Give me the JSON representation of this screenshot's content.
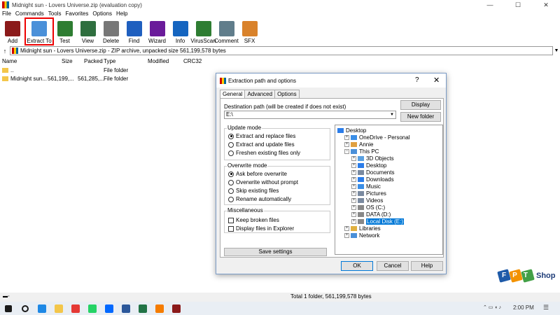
{
  "window": {
    "title": "Midnight sun - Lovers Universe.zip (evaluation copy)",
    "minimize": "—",
    "maximize": "☐",
    "close": "✕"
  },
  "menu": [
    "File",
    "Commands",
    "Tools",
    "Favorites",
    "Options",
    "Help"
  ],
  "toolbar": [
    {
      "label": "Add",
      "icon": "add-archive-icon",
      "color": "#8b1a1a"
    },
    {
      "label": "Extract To",
      "icon": "extract-folder-icon",
      "color": "#4a90d9",
      "selected": true
    },
    {
      "label": "Test",
      "icon": "test-icon",
      "color": "#2e7d32"
    },
    {
      "label": "View",
      "icon": "view-book-icon",
      "color": "#2f6f3f"
    },
    {
      "label": "Delete",
      "icon": "delete-bin-icon",
      "color": "#777777"
    },
    {
      "label": "Find",
      "icon": "find-magnifier-icon",
      "color": "#1f5fbf"
    },
    {
      "label": "Wizard",
      "icon": "wizard-wand-icon",
      "color": "#6a1b9a"
    },
    {
      "label": "Info",
      "icon": "info-icon",
      "color": "#1565c0"
    },
    {
      "label": "VirusScan",
      "icon": "virus-scan-icon",
      "color": "#2e7d32"
    },
    {
      "label": "Comment",
      "icon": "comment-icon",
      "color": "#607d8b"
    },
    {
      "label": "SFX",
      "icon": "sfx-box-icon",
      "color": "#d9822b"
    }
  ],
  "address": {
    "text": "Midnight sun - Lovers Universe.zip - ZIP archive, unpacked size 561,199,578 bytes",
    "up": "↑"
  },
  "columns": [
    "Name",
    "Size",
    "Packed",
    "Type",
    "Modified",
    "CRC32"
  ],
  "files": [
    {
      "name": "..",
      "size": "",
      "packed": "",
      "type": "File folder",
      "modified": "",
      "crc": ""
    },
    {
      "name": "Midnight sun...",
      "size": "561,199,...",
      "packed": "561,285,...",
      "type": "File folder",
      "modified": "",
      "crc": ""
    }
  ],
  "dialog": {
    "title": "Extraction path and options",
    "help": "?",
    "close": "✕",
    "tabs": [
      "General",
      "Advanced",
      "Options"
    ],
    "dest_label": "Destination path (will be created if does not exist)",
    "dest_value": "E:\\",
    "display_btn": "Display",
    "new_folder_btn": "New folder",
    "update_mode": {
      "title": "Update mode",
      "options": [
        "Extract and replace files",
        "Extract and update files",
        "Freshen existing files only"
      ],
      "selected": 0
    },
    "overwrite_mode": {
      "title": "Overwrite mode",
      "options": [
        "Ask before overwrite",
        "Overwrite without prompt",
        "Skip existing files",
        "Rename automatically"
      ],
      "selected": 0
    },
    "misc": {
      "title": "Miscellaneous",
      "options": [
        "Keep broken files",
        "Display files in Explorer"
      ]
    },
    "save_btn": "Save settings",
    "tree": [
      {
        "label": "Desktop",
        "level": 0,
        "exp": "",
        "color": "#2b7de9"
      },
      {
        "label": "OneDrive - Personal",
        "level": 1,
        "exp": "+",
        "color": "#3a8ee6"
      },
      {
        "label": "Annie",
        "level": 1,
        "exp": "+",
        "color": "#e0a040"
      },
      {
        "label": "This PC",
        "level": 1,
        "exp": "−",
        "color": "#4a90d9"
      },
      {
        "label": "3D Objects",
        "level": 2,
        "exp": "+",
        "color": "#5aa0e0"
      },
      {
        "label": "Desktop",
        "level": 2,
        "exp": "+",
        "color": "#2b7de9"
      },
      {
        "label": "Documents",
        "level": 2,
        "exp": "+",
        "color": "#7a8aa0"
      },
      {
        "label": "Downloads",
        "level": 2,
        "exp": "+",
        "color": "#2b7de9"
      },
      {
        "label": "Music",
        "level": 2,
        "exp": "+",
        "color": "#3a8ee6"
      },
      {
        "label": "Pictures",
        "level": 2,
        "exp": "+",
        "color": "#7a8aa0"
      },
      {
        "label": "Videos",
        "level": 2,
        "exp": "+",
        "color": "#7a8aa0"
      },
      {
        "label": "OS (C:)",
        "level": 2,
        "exp": "+",
        "color": "#888888"
      },
      {
        "label": "DATA (D:)",
        "level": 2,
        "exp": "+",
        "color": "#888888"
      },
      {
        "label": "Local Disk (E:)",
        "level": 2,
        "exp": "+",
        "color": "#888888",
        "selected": true
      },
      {
        "label": "Libraries",
        "level": 1,
        "exp": "+",
        "color": "#e0b040"
      },
      {
        "label": "Network",
        "level": 1,
        "exp": "+",
        "color": "#4a90d9"
      }
    ],
    "ok": "OK",
    "cancel": "Cancel",
    "help_btn": "Help"
  },
  "status": {
    "text": "Total 1 folder, 561,199,578 bytes"
  },
  "taskbar": {
    "apps": [
      {
        "icon": "windows-start-icon",
        "color": "#1a1a1a"
      },
      {
        "icon": "search-icon",
        "color": "#1a1a1a"
      },
      {
        "icon": "edge-browser-icon",
        "color": "#1e88e5"
      },
      {
        "icon": "file-explorer-icon",
        "color": "#f3c64a"
      },
      {
        "icon": "chrome-browser-icon",
        "color": "#e53935"
      },
      {
        "icon": "whatsapp-icon",
        "color": "#25d366"
      },
      {
        "icon": "zalo-icon",
        "color": "#0068ff"
      },
      {
        "icon": "word-icon",
        "color": "#2b579a"
      },
      {
        "icon": "excel-icon",
        "color": "#217346"
      },
      {
        "icon": "coccoc-browser-icon",
        "color": "#f57c00"
      },
      {
        "icon": "winrar-taskbar-icon",
        "color": "#8b1a1a"
      }
    ],
    "time": "2:00 PM"
  },
  "watermark": {
    "brand": "FPT",
    "shop": "Shop",
    "colors": [
      "#1e5aa8",
      "#f39200",
      "#43a047"
    ]
  }
}
